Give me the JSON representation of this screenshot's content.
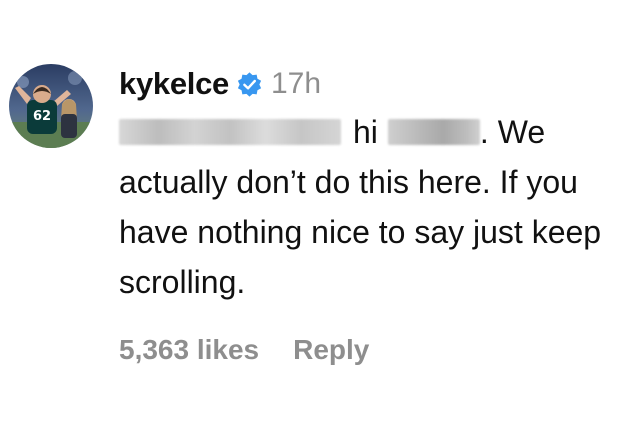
{
  "comment": {
    "username": "kykelce",
    "verified": true,
    "verified_color": "#3897f0",
    "time_ago": "17h",
    "text_part1": "hi",
    "text_part2": ". We actually don’t do this here. If you have nothing nice to say just keep scrolling.",
    "mention_redacted": true,
    "name_redacted": true,
    "likes_label": "5,363 likes",
    "reply_label": "Reply"
  }
}
